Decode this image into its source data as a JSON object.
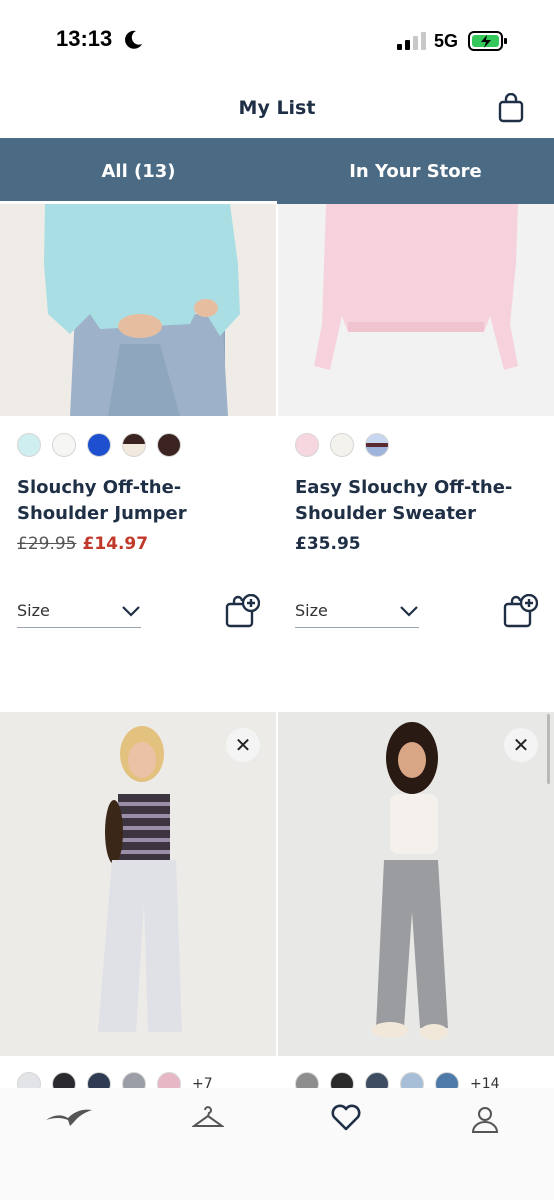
{
  "status": {
    "time": "13:13",
    "network": "5G"
  },
  "header": {
    "title": "My List"
  },
  "tabs": [
    {
      "label": "All (13)",
      "active": true
    },
    {
      "label": "In Your Store",
      "active": false
    }
  ],
  "products": [
    {
      "name": "Slouchy Off-the-Shoulder Jumper",
      "price_old": "£29.95",
      "price": "£14.97",
      "size_label": "Size",
      "swatches": [
        "#cfeef0",
        "#f6f6f4",
        "#1d4fcf",
        "#6b4d3a",
        "#3a2320"
      ]
    },
    {
      "name": "Easy Slouchy Off-the-Shoulder Sweater",
      "price": "£35.95",
      "size_label": "Size",
      "swatches": [
        "#f6d7e0",
        "#f4f2ec",
        "#5b6f9a"
      ]
    },
    {
      "swatches": [
        "#e3e4e8",
        "#2b2b2f",
        "#2e3b52",
        "#9b9ea6",
        "#e8b7c6"
      ],
      "more": "+7"
    },
    {
      "swatches": [
        "#8d8d8d",
        "#2a2a2a",
        "#3e4d62",
        "#a7bfd6",
        "#4d7aa8"
      ],
      "more": "+14"
    }
  ],
  "colors": {
    "accent": "#4b6a84",
    "text": "#1f2f45",
    "sale": "#c0392b"
  },
  "nav": [
    {
      "icon": "seagull-logo-icon"
    },
    {
      "icon": "hanger-icon"
    },
    {
      "icon": "heart-icon"
    },
    {
      "icon": "account-icon"
    }
  ]
}
